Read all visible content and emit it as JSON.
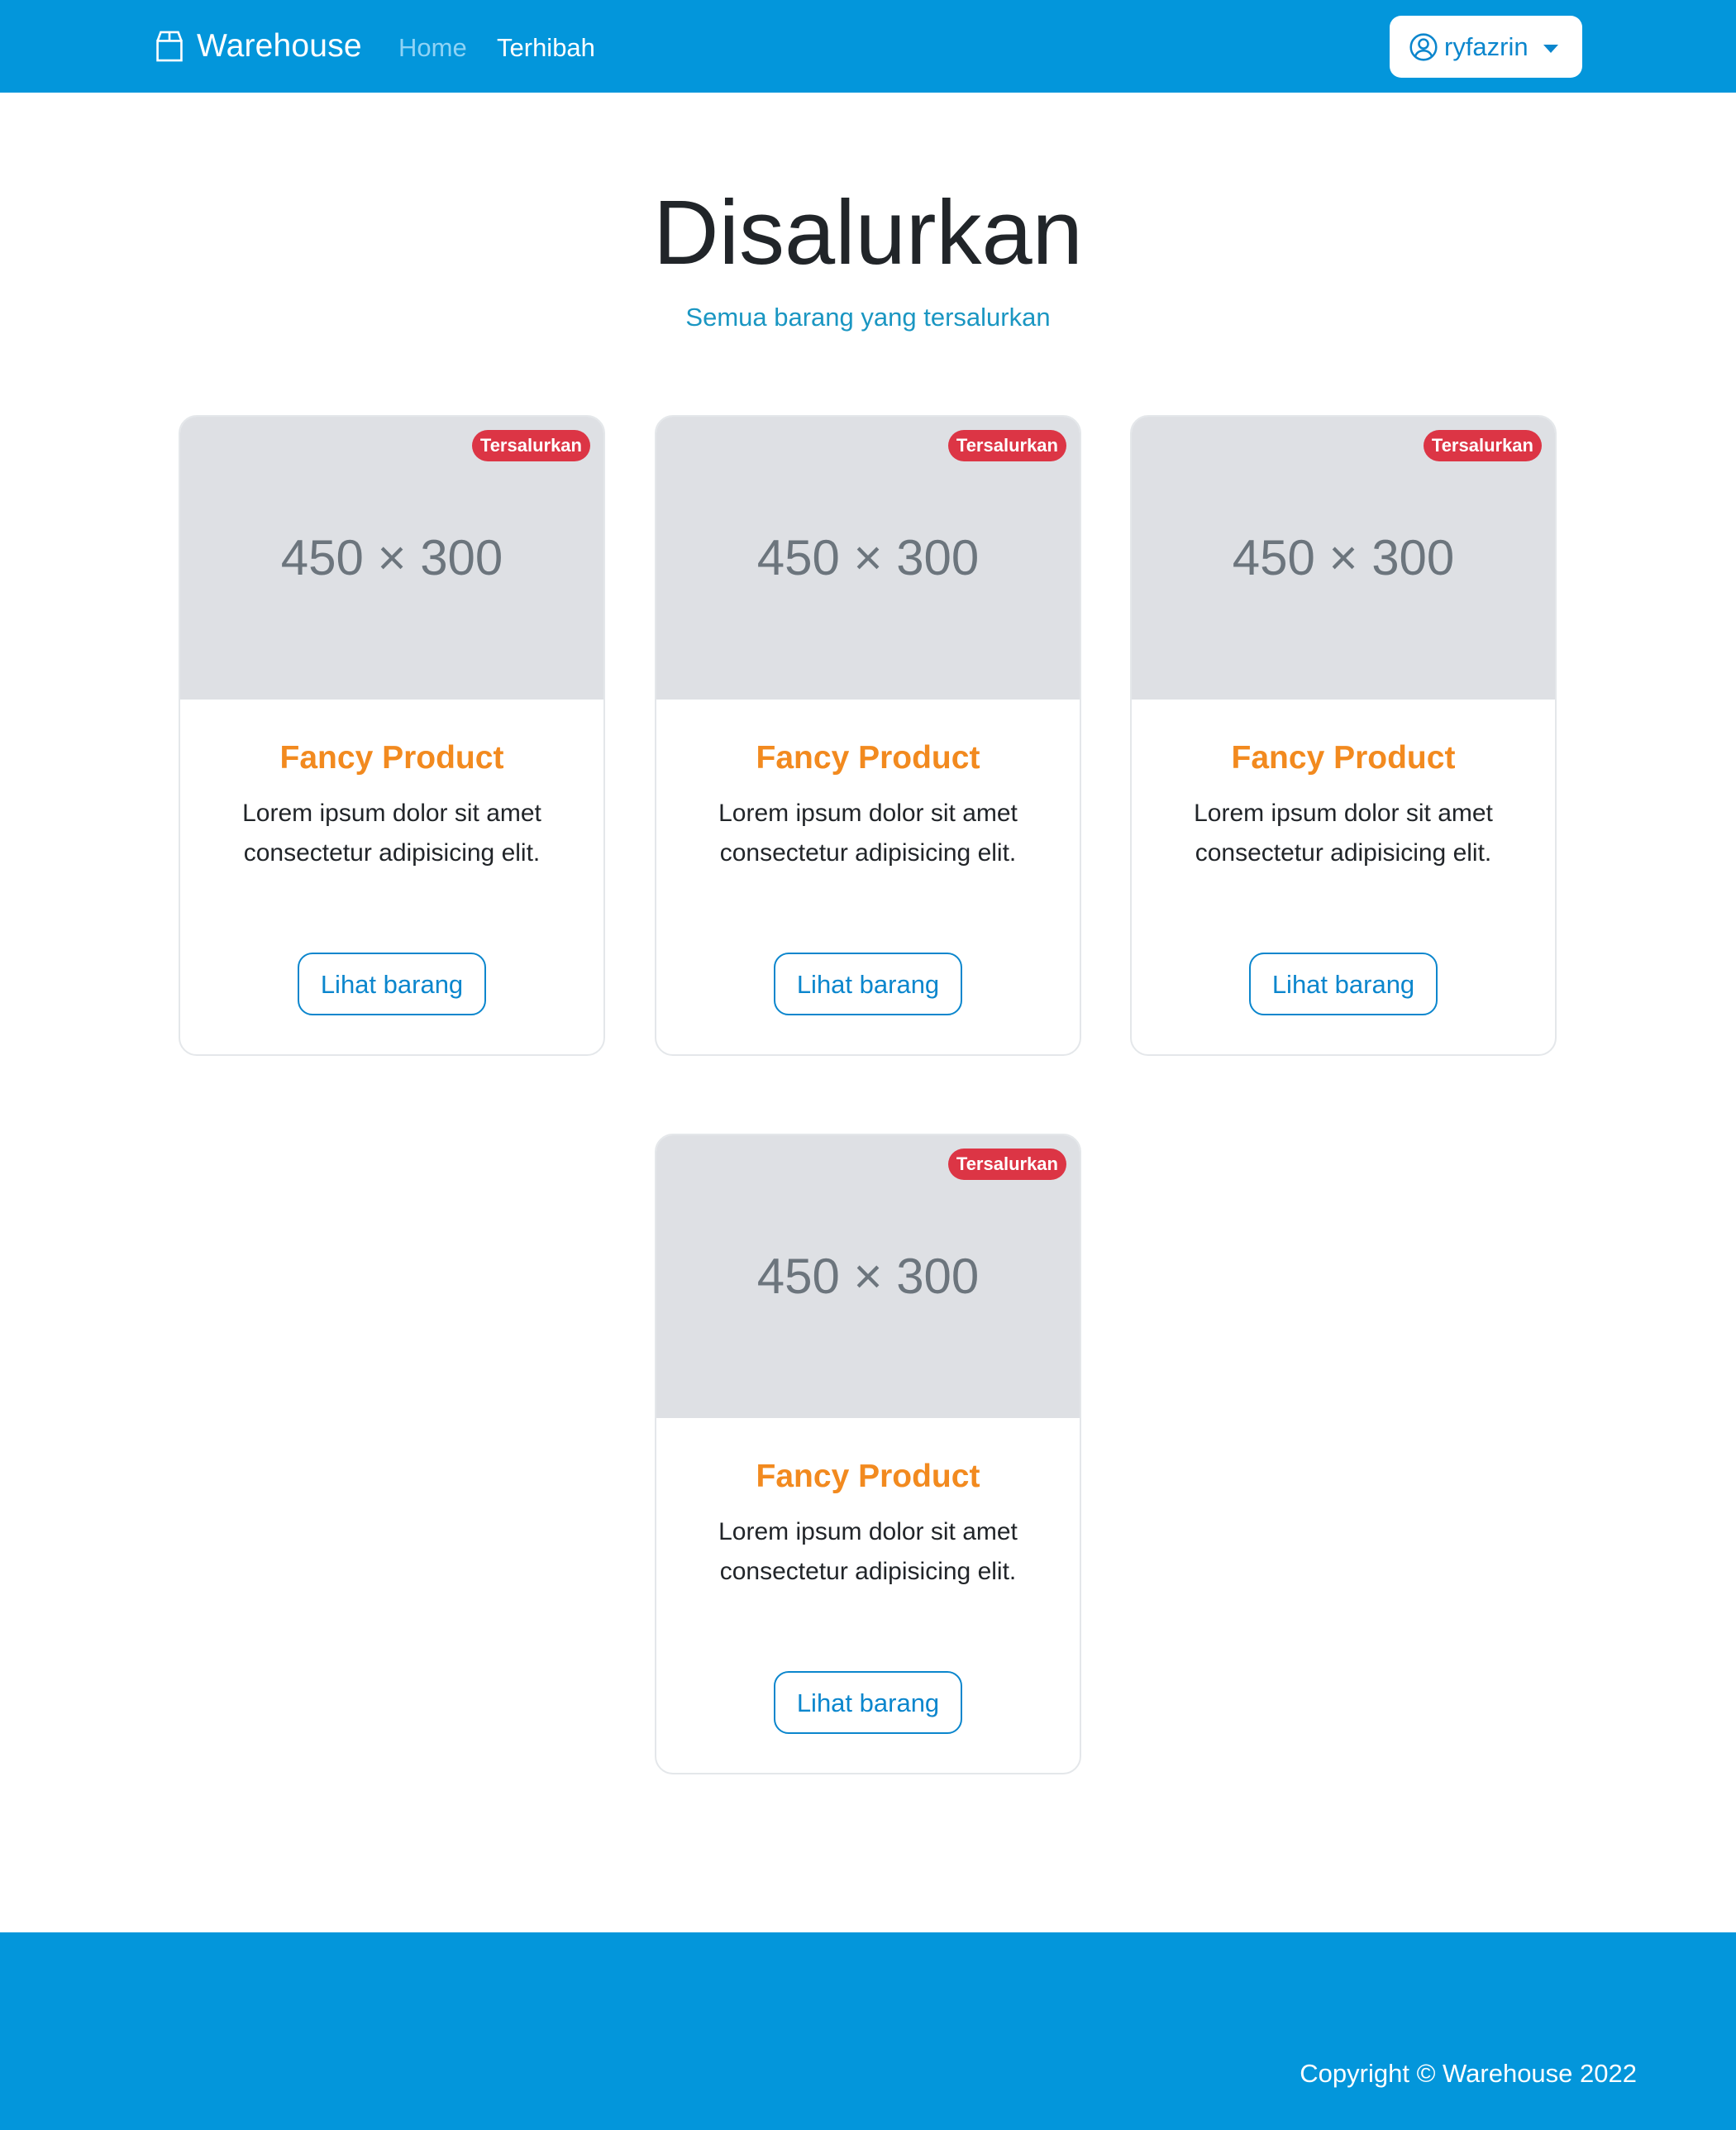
{
  "navbar": {
    "brand": "Warehouse",
    "links": [
      {
        "label": "Home"
      },
      {
        "label": "Terhibah"
      }
    ],
    "user": {
      "name": "ryfazrin"
    }
  },
  "header": {
    "title": "Disalurkan",
    "subtitle": "Semua barang yang tersalurkan"
  },
  "cards": [
    {
      "image_label": "450 × 300",
      "badge": "Tersalurkan",
      "title": "Fancy Product",
      "text": "Lorem ipsum dolor sit amet consectetur adipisicing elit.",
      "button": "Lihat barang"
    },
    {
      "image_label": "450 × 300",
      "badge": "Tersalurkan",
      "title": "Fancy Product",
      "text": "Lorem ipsum dolor sit amet consectetur adipisicing elit.",
      "button": "Lihat barang"
    },
    {
      "image_label": "450 × 300",
      "badge": "Tersalurkan",
      "title": "Fancy Product",
      "text": "Lorem ipsum dolor sit amet consectetur adipisicing elit.",
      "button": "Lihat barang"
    },
    {
      "image_label": "450 × 300",
      "badge": "Tersalurkan",
      "title": "Fancy Product",
      "text": "Lorem ipsum dolor sit amet consectetur adipisicing elit.",
      "button": "Lihat barang"
    }
  ],
  "footer": {
    "copyright": "Copyright © Warehouse 2022"
  },
  "colors": {
    "primary": "#0396db",
    "accent": "#f28a1f",
    "badge": "#dc3545",
    "placeholder": "#dee0e4"
  }
}
